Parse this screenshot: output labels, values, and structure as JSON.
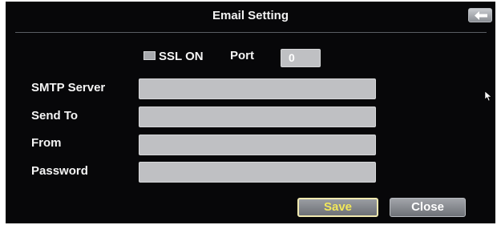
{
  "window": {
    "title": "Email Setting"
  },
  "ssl": {
    "label": "SSL ON",
    "checked": false
  },
  "port": {
    "label": "Port",
    "value": "0"
  },
  "fields": {
    "smtp_server": {
      "label": "SMTP Server",
      "value": ""
    },
    "send_to": {
      "label": "Send To",
      "value": ""
    },
    "from": {
      "label": "From",
      "value": ""
    },
    "password": {
      "label": "Password",
      "value": ""
    }
  },
  "buttons": {
    "save_label": "Save",
    "close_label": "Close"
  },
  "icons": {
    "back": "back-arrow-icon",
    "ssl_checkbox": "checkbox-icon",
    "cursor": "mouse-pointer-icon"
  },
  "colors": {
    "background": "#070709",
    "field": "#bfc0c3",
    "save_text": "#f2e85a",
    "label_text": "#f4f4f4"
  }
}
